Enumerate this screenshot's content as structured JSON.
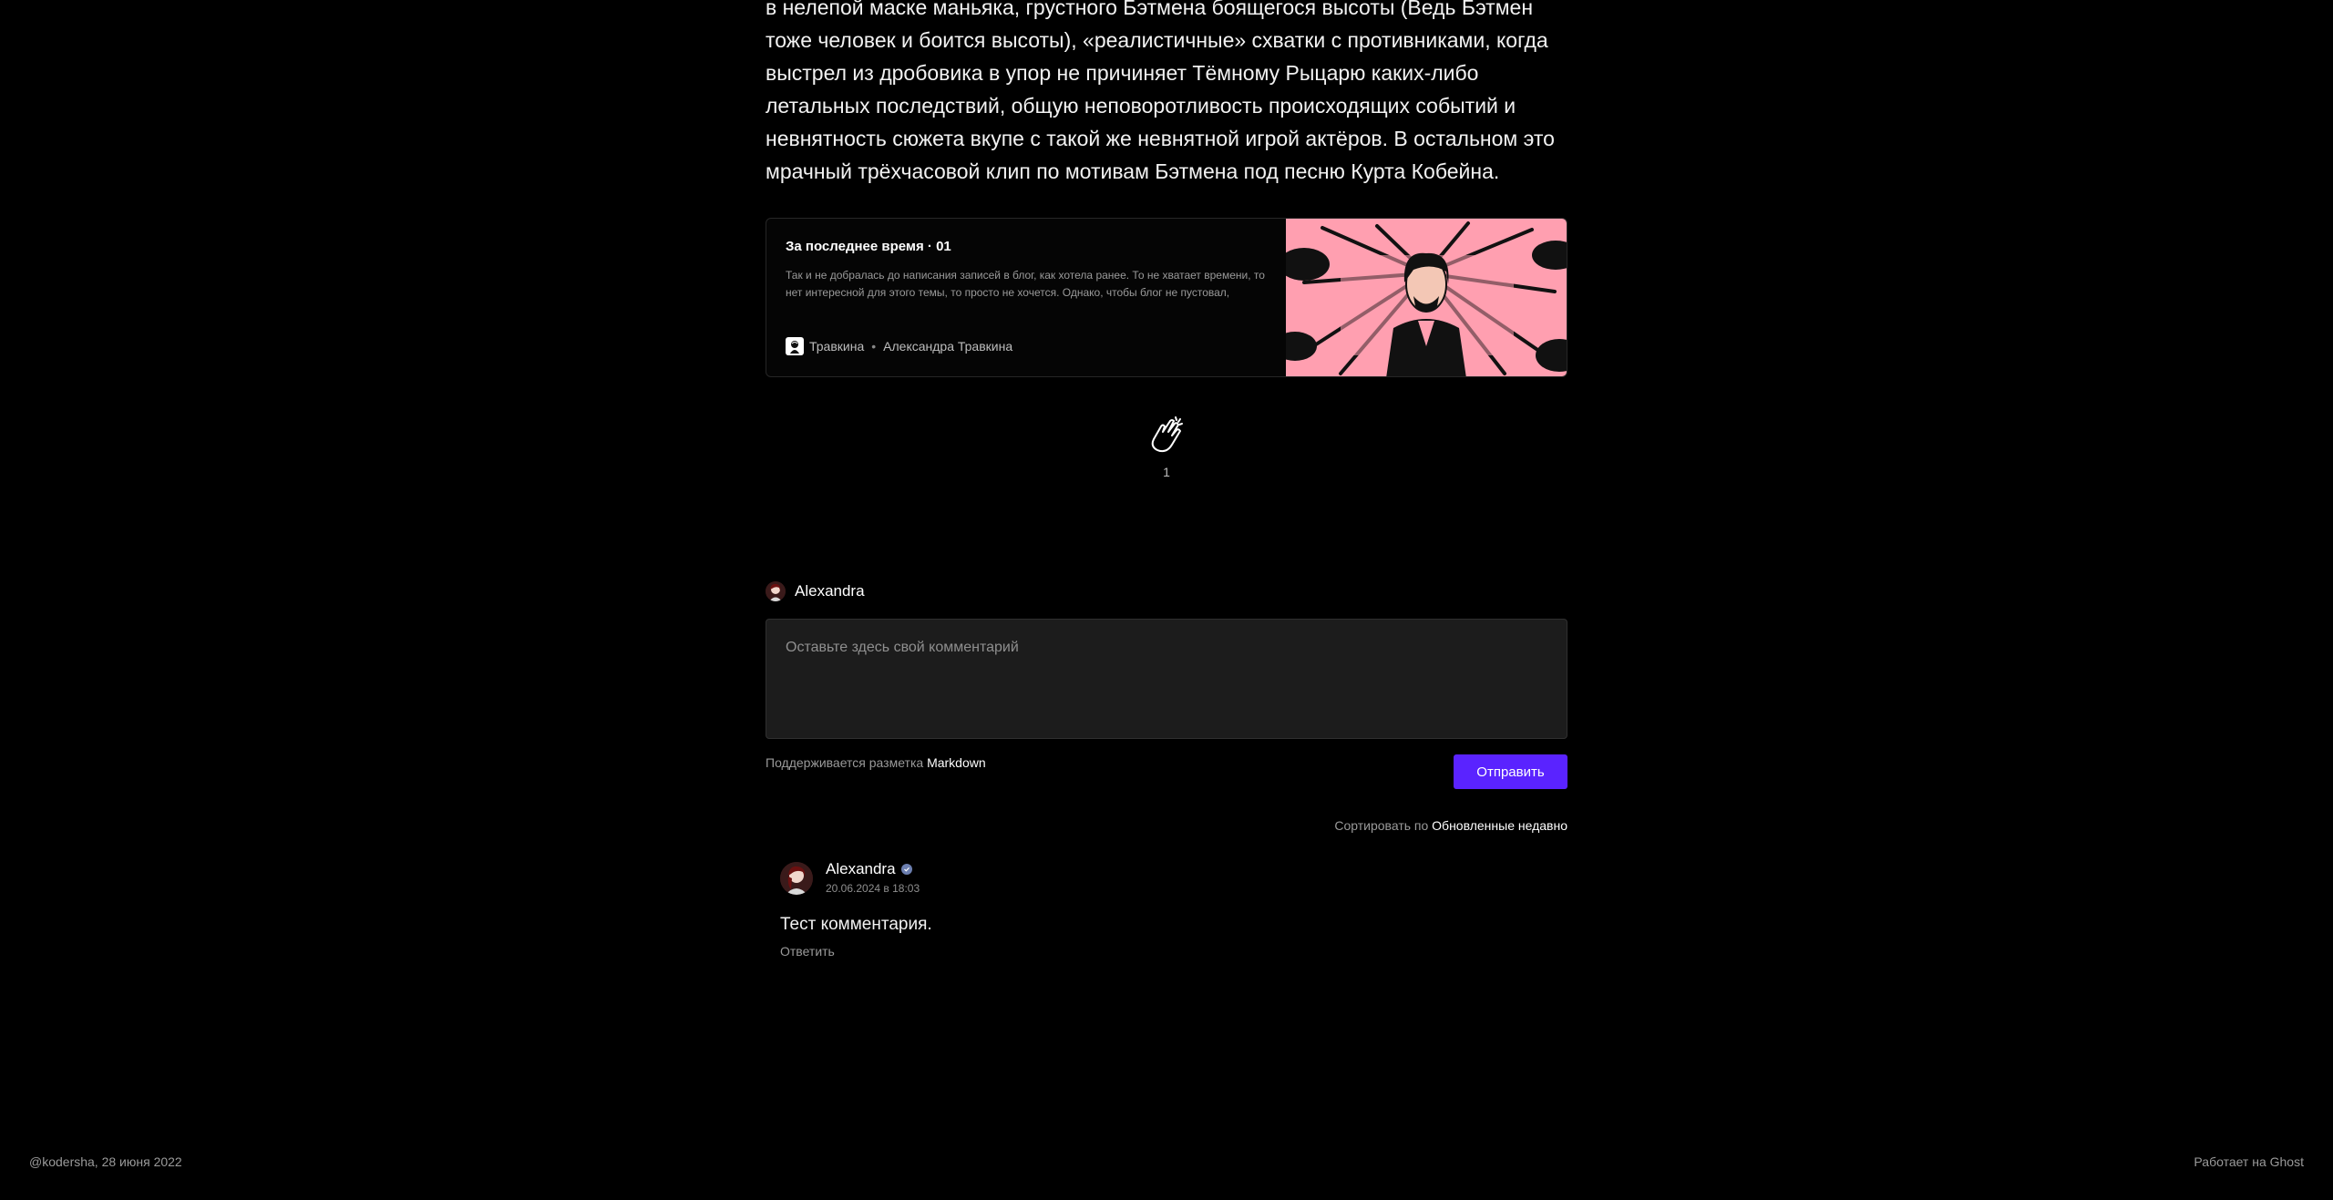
{
  "article": {
    "paragraph": "в нелепой маске маньяка, грустного Бэтмена боящегося высоты (Ведь Бэтмен тоже человек и боится высоты), «реалистичные» схватки с противниками, когда выстрел из дробовика в упор не причиняет Тёмному Рыцарю каких-либо летальных последствий, общую неповоротливость происходящих событий и невнятность сюжета вкупе с такой же невнятной игрой актёров. В остальном это мрачный трёхчасовой клип по мотивам Бэтмена под песню Курта Кобейна."
  },
  "bookmark": {
    "title": "За последнее время · 01",
    "description": "Так и не добралась до написания записей в блог, как хотела ранее. То не хватает времени, то нет интересной для этого темы, то просто не хочется. Однако, чтобы блог не пустовал, решила сделать небольшую подборку.",
    "publisher": "Травкина",
    "separator": "•",
    "author": "Александра Травкина",
    "thumbnail_bg": "#ff9fb0"
  },
  "reactions": {
    "icon": "clap-icon",
    "count": "1"
  },
  "comment_form": {
    "user_name": "Alexandra",
    "placeholder": "Оставьте здесь свой комментарий",
    "markdown_prefix": "Поддерживается разметка",
    "markdown_link": "Markdown",
    "submit_label": "Отправить",
    "accent": "#5a23ff"
  },
  "sort": {
    "prefix": "Сортировать по",
    "value": "Обновленные недавно"
  },
  "comments": [
    {
      "author": "Alexandra",
      "date": "20.06.2024 в 18:03",
      "body": "Тест комментария.",
      "reply_label": "Ответить"
    }
  ],
  "footer": {
    "left": "@kodersha, 28 июня 2022",
    "right": "Работает на Ghost"
  }
}
